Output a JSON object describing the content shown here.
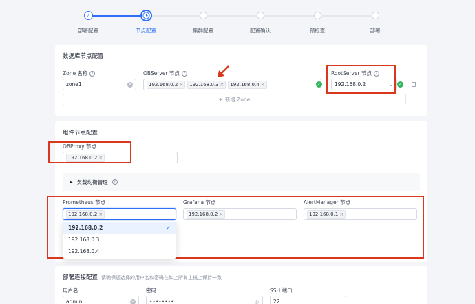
{
  "steps": [
    {
      "label": "部署配置",
      "state": "done"
    },
    {
      "label": "节点配置",
      "state": "active"
    },
    {
      "label": "集群配置",
      "state": "todo"
    },
    {
      "label": "配置确认",
      "state": "todo"
    },
    {
      "label": "预检查",
      "state": "todo"
    },
    {
      "label": "部署",
      "state": "todo"
    }
  ],
  "db_section": {
    "title": "数据库节点配置",
    "zone_label": "Zone 名称",
    "zone_value": "zone1",
    "observer_label": "OBServer 节点",
    "observer_tags": [
      "192.168.0.2",
      "192.168.0.3",
      "192.168.0.4"
    ],
    "rootserver_label": "RootServer 节点",
    "rootserver_value": "192.168.0.2",
    "add_zone_label": "新增 Zone"
  },
  "component_section": {
    "title": "组件节点配置",
    "obproxy_label": "OBProxy 节点",
    "obproxy_tags": [
      "192.168.0.2"
    ],
    "lb_label": "负载均衡管理",
    "prometheus_label": "Prometheus 节点",
    "prometheus_tags": [
      "192.168.0.2"
    ],
    "grafana_label": "Grafana 节点",
    "grafana_tags": [
      "192.168.0.2"
    ],
    "alertmanager_label": "AlertManager 节点",
    "alertmanager_tags": [
      "192.168.0.1"
    ],
    "dropdown_options": [
      {
        "label": "192.168.0.2",
        "selected": true
      },
      {
        "label": "192.168.0.3",
        "selected": false
      },
      {
        "label": "192.168.0.4",
        "selected": false
      }
    ]
  },
  "ssh_section": {
    "title": "部署连接配置",
    "hint": "请确保您选择的用户名和密码在如上所有主机上保持一致",
    "username_label": "用户名",
    "username_value": "admin",
    "password_label": "密码",
    "password_value": "••••••••",
    "port_label": "SSH 端口",
    "port_value": "22"
  },
  "colors": {
    "primary": "#2f6ff5",
    "annotation_red": "#d9381e",
    "success": "#2db65a"
  }
}
